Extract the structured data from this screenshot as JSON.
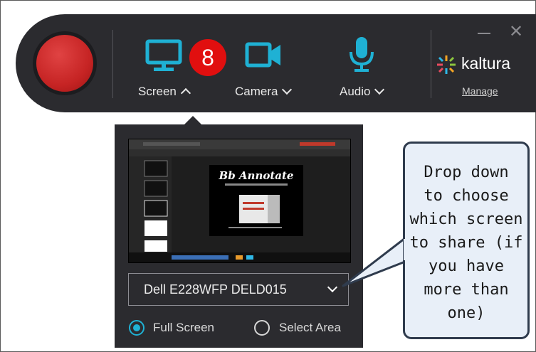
{
  "toolbar": {
    "sources": [
      {
        "label": "Screen",
        "icon": "monitor-icon",
        "expanded": true
      },
      {
        "label": "Camera",
        "icon": "video-camera-icon",
        "expanded": false
      },
      {
        "label": "Audio",
        "icon": "microphone-icon",
        "expanded": false
      }
    ],
    "badge": "8",
    "brand": "kaltura",
    "manage": "Manage",
    "accent_color": "#1fb1d4",
    "record_color": "#c62424",
    "window_controls": [
      "minimize-icon",
      "close-icon"
    ]
  },
  "screen_panel": {
    "preview_app_title": "Bb Annotate",
    "selected_display": "Dell E228WFP DELD015",
    "capture_modes": [
      {
        "label": "Full Screen",
        "selected": true
      },
      {
        "label": "Select Area",
        "selected": false
      }
    ]
  },
  "callout": {
    "text": "Drop down\nto choose\nwhich screen\nto share (if\nyou have\nmore than\none)"
  }
}
